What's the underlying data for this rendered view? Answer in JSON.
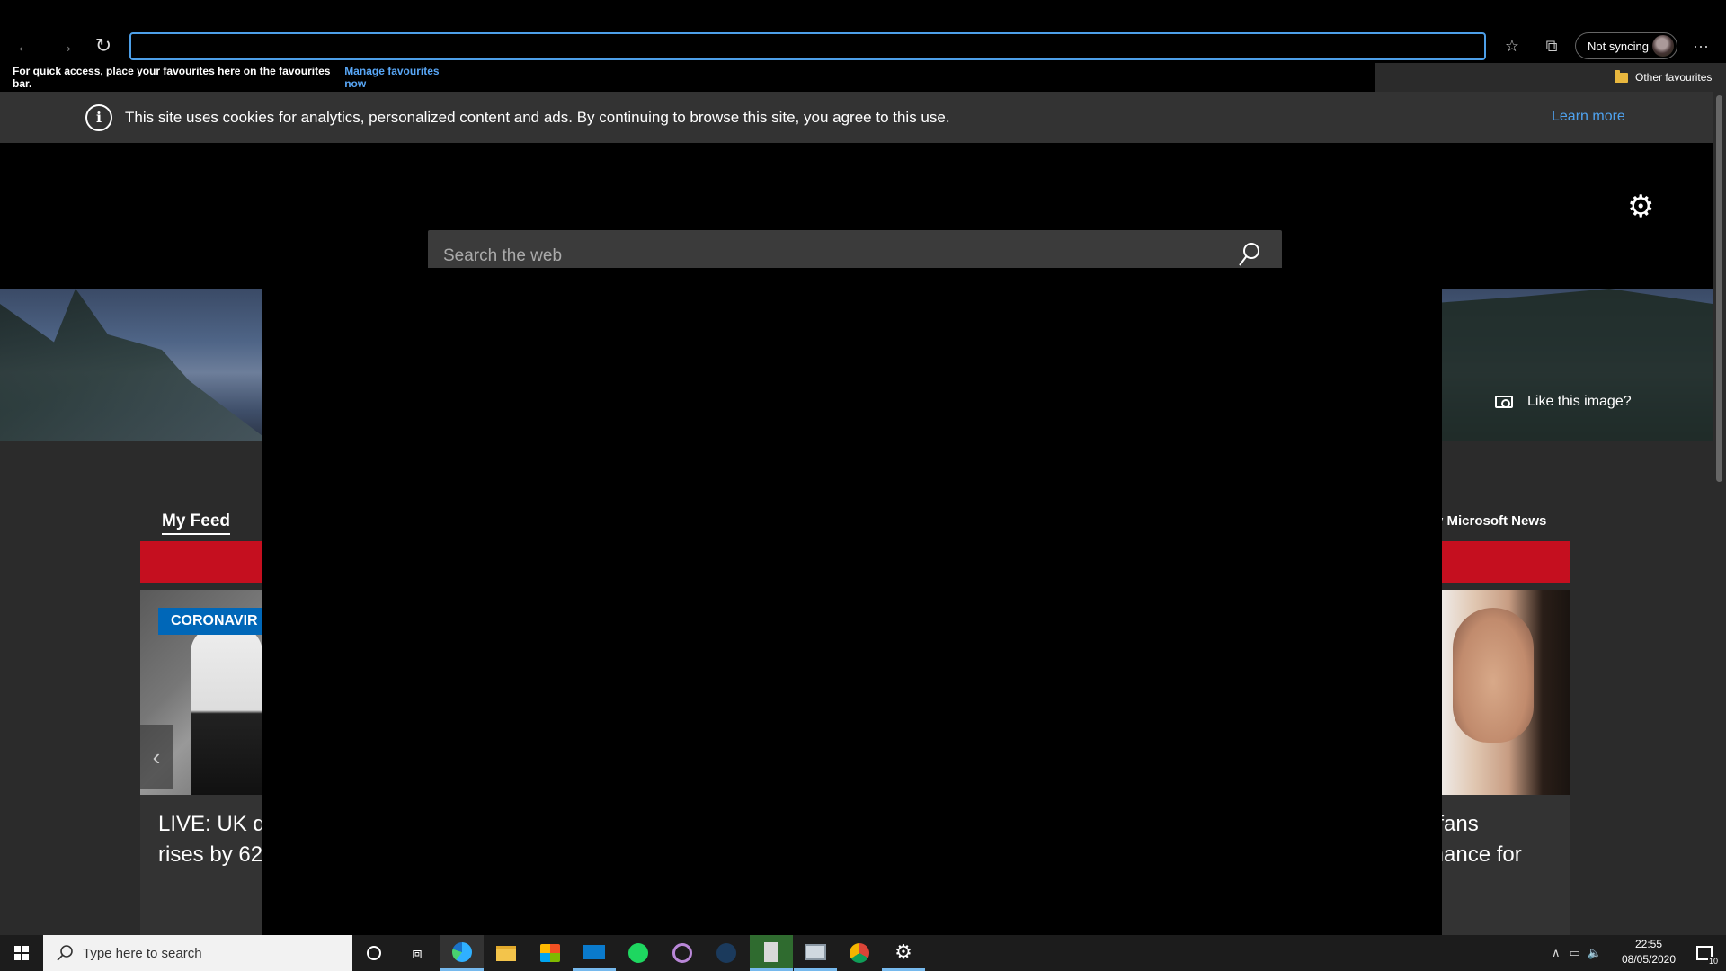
{
  "browser": {
    "address_value": "",
    "sync_label": "Not syncing",
    "favbar_message": "For quick access, place your favourites here on the favourites bar.",
    "favbar_link": "Manage favourites now",
    "other_favourites": "Other favourites"
  },
  "page": {
    "cookie_message": "This site uses cookies for analytics, personalized content and ads. By continuing to browse this site, you agree to this use.",
    "learn_more": "Learn more",
    "search_placeholder": "Search the web",
    "like_image": "Like this image?",
    "my_feed": "My Feed",
    "powered_by": "y Microsoft News",
    "card1": {
      "badge": "CORONAVIR",
      "title_line1": "LIVE: UK de",
      "title_line2": "rises by 62"
    },
    "card2": {
      "title_line1": "t fans",
      "title_line2": "mance for"
    }
  },
  "taskbar": {
    "search_placeholder": "Type here to search",
    "time": "22:55",
    "date": "08/05/2020",
    "notification_count": "10",
    "apps": [
      "cortana-icon",
      "task-view-icon",
      "edge-icon",
      "file-explorer-icon",
      "store-icon",
      "mail-icon",
      "spotify-icon",
      "media-player-icon",
      "steam-icon",
      "app-icon",
      "pc-icon",
      "chrome-icon",
      "settings-icon"
    ]
  },
  "colors": {
    "accent": "#4d9fe8",
    "link": "#58a6f5",
    "news_red": "#c50f1f",
    "badge_blue": "#0067b8"
  }
}
